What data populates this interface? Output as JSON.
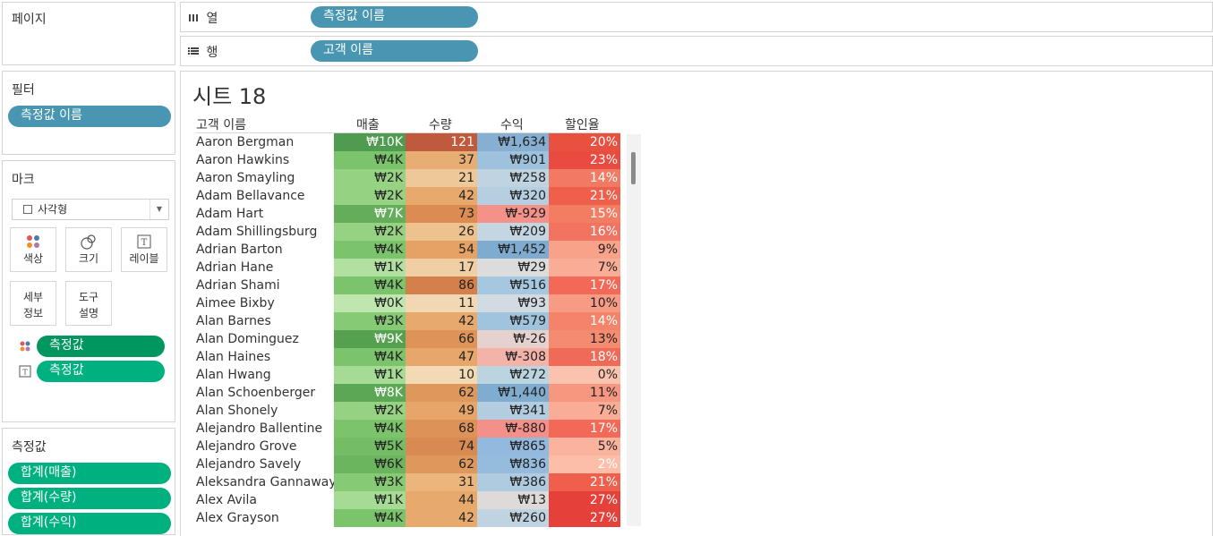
{
  "pages_panel": {
    "title": "페이지"
  },
  "columns_shelf": {
    "icon": "columns-icon",
    "label": "열",
    "pill": "측정값 이름"
  },
  "rows_shelf": {
    "icon": "rows-icon",
    "label": "행",
    "pill": "고객 이름"
  },
  "filters_panel": {
    "title": "필터",
    "pill": "측정값 이름"
  },
  "marks_panel": {
    "title": "마크",
    "mark_type": "사각형",
    "buttons": {
      "color": "색상",
      "size": "크기",
      "label": "레이블",
      "detail": "세부\n정보",
      "tooltip": "도구\n설명"
    },
    "detail_line1": "세부",
    "detail_line2": "정보",
    "tooltip_line1": "도구",
    "tooltip_line2": "설명",
    "pills": [
      {
        "icon": "color-dots-icon",
        "text": "측정값"
      },
      {
        "icon": "text-label-icon",
        "text": "측정값"
      }
    ]
  },
  "measure_values_panel": {
    "title": "측정값",
    "pills": [
      "합계(매출)",
      "합계(수량)",
      "합계(수익)"
    ]
  },
  "sheet": {
    "title": "시트 18",
    "row_header": "고객 이름",
    "columns": [
      "매출",
      "수량",
      "수익",
      "할인율"
    ]
  },
  "table": [
    {
      "name": "Aaron Bergman",
      "sales": "₩10K",
      "qty": "121",
      "profit": "₩1,634",
      "disc": "20%",
      "c": [
        "#4f9b4f",
        "#bf5a3c",
        "#86afd1",
        "#e8503f"
      ]
    },
    {
      "name": "Aaron Hawkins",
      "sales": "₩4K",
      "qty": "37",
      "profit": "₩901",
      "disc": "23%",
      "c": [
        "#7cc46b",
        "#e7ad72",
        "#9ec1dd",
        "#ea4b40"
      ]
    },
    {
      "name": "Aaron Smayling",
      "sales": "₩2K",
      "qty": "21",
      "profit": "₩258",
      "disc": "14%",
      "c": [
        "#95d383",
        "#eec899",
        "#bfd4e0",
        "#f27a62"
      ]
    },
    {
      "name": "Adam Bellavance",
      "sales": "₩2K",
      "qty": "42",
      "profit": "₩320",
      "disc": "21%",
      "c": [
        "#95d383",
        "#e8a96d",
        "#b5cfe0",
        "#ef5f4b"
      ]
    },
    {
      "name": "Adam Hart",
      "sales": "₩7K",
      "qty": "73",
      "profit": "₩-929",
      "disc": "15%",
      "c": [
        "#64ad5a",
        "#dc8c53",
        "#f4928a",
        "#f27d63"
      ]
    },
    {
      "name": "Adam Shillingsburg",
      "sales": "₩2K",
      "qty": "26",
      "profit": "₩209",
      "disc": "16%",
      "c": [
        "#95d383",
        "#edc28e",
        "#c3d6e1",
        "#f27360"
      ]
    },
    {
      "name": "Adrian Barton",
      "sales": "₩4K",
      "qty": "54",
      "profit": "₩1,452",
      "disc": "9%",
      "c": [
        "#7cc46b",
        "#e6a264",
        "#7fabd0",
        "#f8a28a"
      ]
    },
    {
      "name": "Adrian Hane",
      "sales": "₩1K",
      "qty": "17",
      "profit": "₩29",
      "disc": "7%",
      "c": [
        "#b1e0a1",
        "#f1cfa4",
        "#dcdcdc",
        "#f9ad97"
      ]
    },
    {
      "name": "Adrian Shami",
      "sales": "₩4K",
      "qty": "86",
      "profit": "₩516",
      "disc": "17%",
      "c": [
        "#7cc46b",
        "#d4804a",
        "#a5c7e0",
        "#f26a57"
      ]
    },
    {
      "name": "Aimee Bixby",
      "sales": "₩0K",
      "qty": "11",
      "profit": "₩93",
      "disc": "10%",
      "c": [
        "#bee6ae",
        "#f2d8b2",
        "#d3dbe2",
        "#f79b85"
      ]
    },
    {
      "name": "Alan Barnes",
      "sales": "₩3K",
      "qty": "42",
      "profit": "₩579",
      "disc": "14%",
      "c": [
        "#86ca75",
        "#e8a96d",
        "#a0c3de",
        "#f48469"
      ]
    },
    {
      "name": "Alan Dominguez",
      "sales": "₩9K",
      "qty": "66",
      "profit": "₩-26",
      "disc": "13%",
      "c": [
        "#56a150",
        "#de9459",
        "#e5d2cf",
        "#f58c72"
      ]
    },
    {
      "name": "Alan Haines",
      "sales": "₩4K",
      "qty": "47",
      "profit": "₩-308",
      "disc": "18%",
      "c": [
        "#7cc46b",
        "#e7a66a",
        "#f4b3a8",
        "#f06b57"
      ]
    },
    {
      "name": "Alan Hwang",
      "sales": "₩1K",
      "qty": "10",
      "profit": "₩272",
      "disc": "0%",
      "c": [
        "#a6db95",
        "#f2dab5",
        "#bcd3e0",
        "#fbc2b0"
      ]
    },
    {
      "name": "Alan Schoenberger",
      "sales": "₩8K",
      "qty": "62",
      "profit": "₩1,440",
      "disc": "11%",
      "c": [
        "#5ca755",
        "#df985c",
        "#80acd0",
        "#f7977f"
      ]
    },
    {
      "name": "Alan Shonely",
      "sales": "₩2K",
      "qty": "49",
      "profit": "₩341",
      "disc": "7%",
      "c": [
        "#95d383",
        "#e7a569",
        "#b3cde0",
        "#f9ad97"
      ]
    },
    {
      "name": "Alejandro Ballentine",
      "sales": "₩4K",
      "qty": "68",
      "profit": "₩-880",
      "disc": "17%",
      "c": [
        "#7cc46b",
        "#dd9257",
        "#f3908a",
        "#f26a57"
      ]
    },
    {
      "name": "Alejandro Grove",
      "sales": "₩5K",
      "qty": "74",
      "profit": "₩865",
      "disc": "5%",
      "c": [
        "#74bd65",
        "#d98a52",
        "#93bade",
        "#fab49e"
      ]
    },
    {
      "name": "Alejandro Savely",
      "sales": "₩6K",
      "qty": "62",
      "profit": "₩836",
      "disc": "2%",
      "c": [
        "#6bb55e",
        "#df985c",
        "#95bcdd",
        "#fcbda9"
      ]
    },
    {
      "name": "Aleksandra Gannaway",
      "sales": "₩3K",
      "qty": "31",
      "profit": "₩386",
      "disc": "21%",
      "c": [
        "#86ca75",
        "#ebb57c",
        "#afcbdf",
        "#ef5f4b"
      ]
    },
    {
      "name": "Alex Avila",
      "sales": "₩1K",
      "qty": "44",
      "profit": "₩13",
      "disc": "27%",
      "c": [
        "#a6db95",
        "#e8a96d",
        "#dedad9",
        "#e6403a"
      ]
    },
    {
      "name": "Alex Grayson",
      "sales": "₩4K",
      "qty": "42",
      "profit": "₩260",
      "disc": "27%",
      "c": [
        "#7cc46b",
        "#e8a96d",
        "#bfd4e0",
        "#e6403a"
      ]
    }
  ]
}
